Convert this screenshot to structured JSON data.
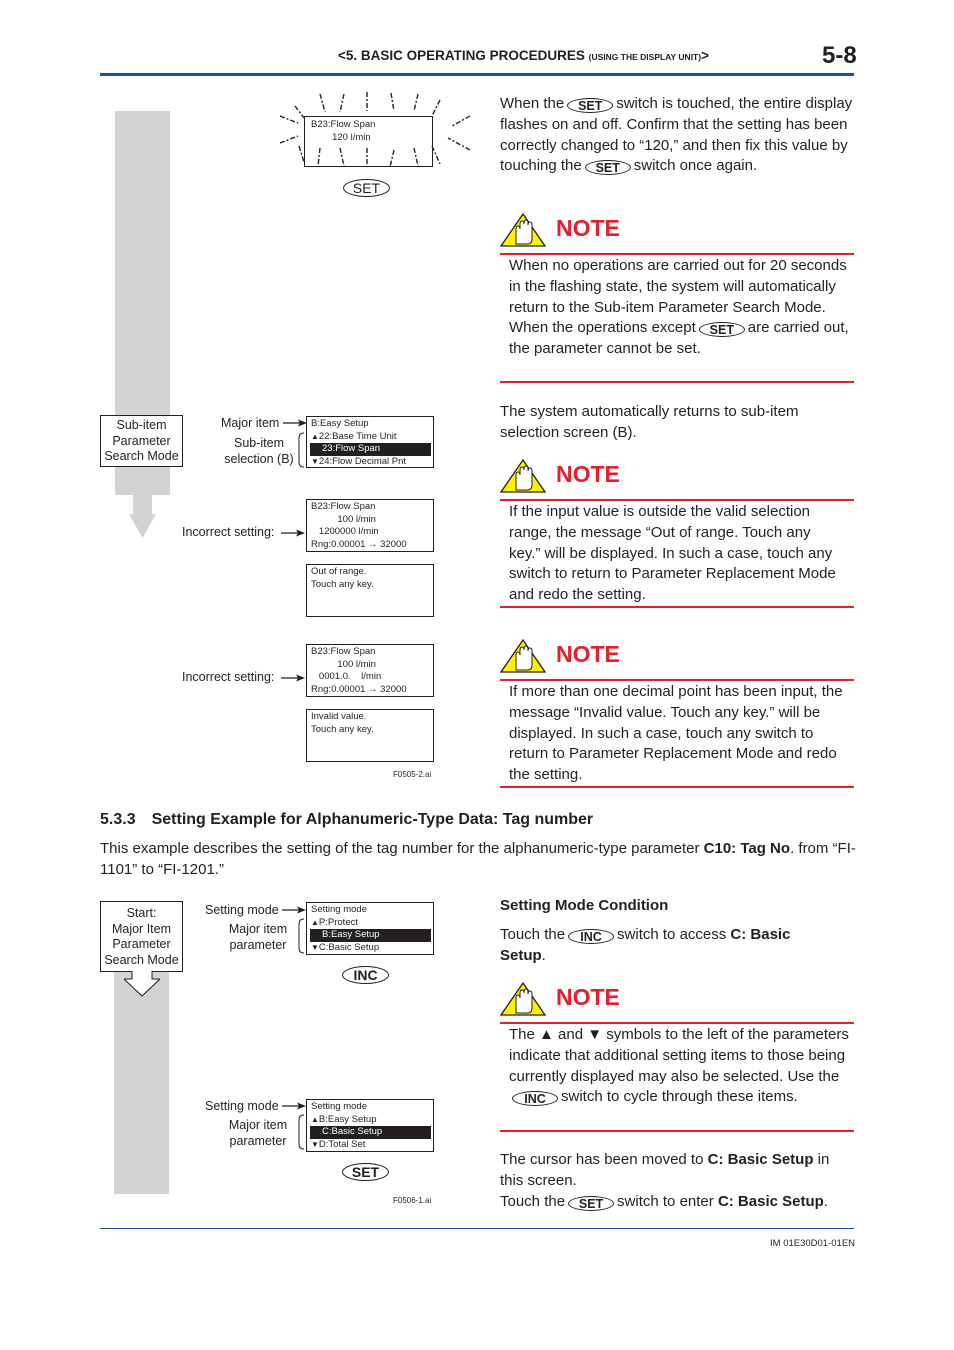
{
  "header": {
    "title_main": "<5.  BASIC OPERATING PROCEDURES ",
    "title_small": "(USING THE DISPLAY UNIT)",
    "title_end": ">",
    "page_number": "5-8"
  },
  "footer": {
    "doc_id": "IM 01E30D01-01EN"
  },
  "colors": {
    "accent_blue": "#1f4e9c",
    "note_red": "#e3202b",
    "note_yellow": "#fff200",
    "flow_gray": "#d2d3d5"
  },
  "figure1": {
    "flash_display": {
      "line1": "B23:Flow Span",
      "line2": "        120 l/min"
    },
    "set_key": "SET",
    "mode_box": [
      "Sub-item",
      "Parameter",
      "Search Mode"
    ],
    "label_major_item": "Major item",
    "label_sub_item": [
      "Sub-item",
      "selection (B)"
    ],
    "subitem_display": {
      "rows": [
        "B:Easy Setup",
        "22:Base Time Unit",
        "23:Flow Span",
        "24:Flow Decimal Pnt"
      ],
      "selected_index": 2
    },
    "incorrect_label": "Incorrect setting:",
    "range_display": {
      "rows": [
        "B23:Flow Span",
        "          100 l/min",
        "   1200000 l/min",
        "Rng:0.00001 → 32000"
      ]
    },
    "range_message": {
      "rows": [
        "Out of range.",
        "Touch any key."
      ]
    },
    "decimal_display": {
      "rows": [
        "B23:Flow Span",
        "          100 l/min",
        "   0001.0.    l/min",
        "Rng:0.00001 → 32000"
      ]
    },
    "decimal_message": {
      "rows": [
        "Invalid value.",
        "Touch any key."
      ]
    },
    "caption": "F0505-2.ai"
  },
  "right1": {
    "para1": {
      "before": "When the",
      "key1": "SET",
      "mid1": "switch is touched, the entire display flashes on and off. Confirm that the setting has been correctly changed to “120,” and then fix this value by touching the",
      "key2": "SET",
      "after": "switch once again."
    },
    "note_label": "NOTE",
    "note1": {
      "text1": "When no operations are carried out for 20 seconds in the flashing state, the system will automatically return to the Sub-item Parameter Search Mode.",
      "text2_before": "When the operations except",
      "key": "SET",
      "text2_after": "are carried out, the parameter cannot be set."
    },
    "para2": "The system automatically returns to sub-item selection screen (B).",
    "note2": "If the input value is outside the valid selection range, the message “Out of range. Touch any key.” will be displayed. In such a case, touch any switch to return to Parameter Replacement Mode and redo the setting.",
    "note3": "If more than one decimal point has been input, the message “Invalid value. Touch any key.” will be displayed. In such a case, touch any switch to return to Parameter Replacement Mode and redo the setting."
  },
  "section": {
    "number": "5.3.3",
    "title": "Setting Example for Alphanumeric-Type Data: Tag number",
    "intro_before": "This example describes the setting of the tag number for the alphanumeric-type parameter ",
    "intro_bold": "C10: Tag No",
    "intro_after": ". from “FI-1101” to “FI-1201.”"
  },
  "figure2": {
    "start_box": [
      "Start:",
      "Major Item",
      "Parameter",
      "Search Mode"
    ],
    "label_setting_mode": "Setting mode",
    "label_major_item": [
      "Major item",
      "parameter"
    ],
    "display1": {
      "rows": [
        "Setting mode",
        "P:Protect",
        "B:Easy Setup",
        "C:Basic Setup"
      ],
      "selected_index": 2
    },
    "inc_key": "INC",
    "display2": {
      "rows": [
        "Setting mode",
        "B:Easy Setup",
        "C:Basic Setup",
        "D:Total Set"
      ],
      "selected_index": 2
    },
    "set_key": "SET",
    "caption": "F0506-1.ai"
  },
  "right2": {
    "heading": "Setting Mode Condition",
    "para1_before": "Touch the",
    "para1_key": "INC",
    "para1_mid": "switch to access ",
    "para1_bold": "C: Basic Setup",
    "para1_end": ".",
    "note_label": "NOTE",
    "note_before": "The ▲ and ▼ symbols to the left of the parameters indicate that additional setting items to those being currently displayed may also be selected. Use the",
    "note_key": "INC",
    "note_after": "switch to cycle through these items.",
    "para2_before": "The cursor has been moved to ",
    "para2_bold": "C: Basic Setup",
    "para2_after": " in this screen.",
    "para3_before": "Touch the",
    "para3_key": "SET",
    "para3_mid": "switch to enter ",
    "para3_bold": "C: Basic Setup",
    "para3_end": "."
  }
}
